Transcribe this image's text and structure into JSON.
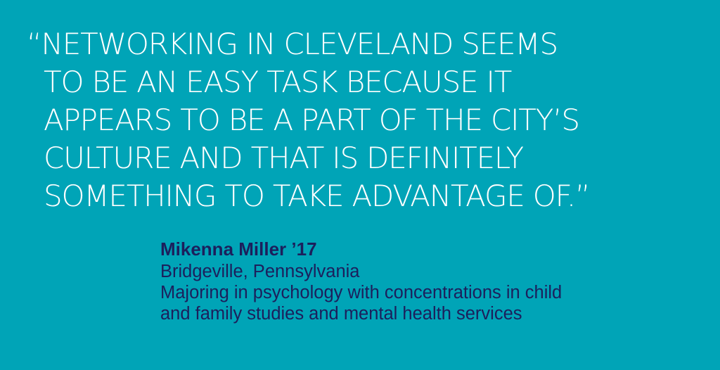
{
  "quote": {
    "lines": [
      "“NETWORKING IN CLEVELAND SEEMS",
      "TO BE AN EASY TASK BECAUSE IT",
      "APPEARS TO BE A PART OF THE CITY’S",
      "CULTURE AND THAT IS DEFINITELY",
      "SOMETHING TO TAKE ADVANTAGE OF.”"
    ]
  },
  "attribution": {
    "name": "Mikenna Miller ’17",
    "hometown": "Bridgeville, Pennsylvania",
    "major_lines": [
      "Majoring in psychology with concentrations in child",
      "and family studies and mental health services"
    ]
  },
  "colors": {
    "background": "#00a4b7",
    "quote_text": "#ffffff",
    "attribution_text": "#1c1f5c"
  }
}
